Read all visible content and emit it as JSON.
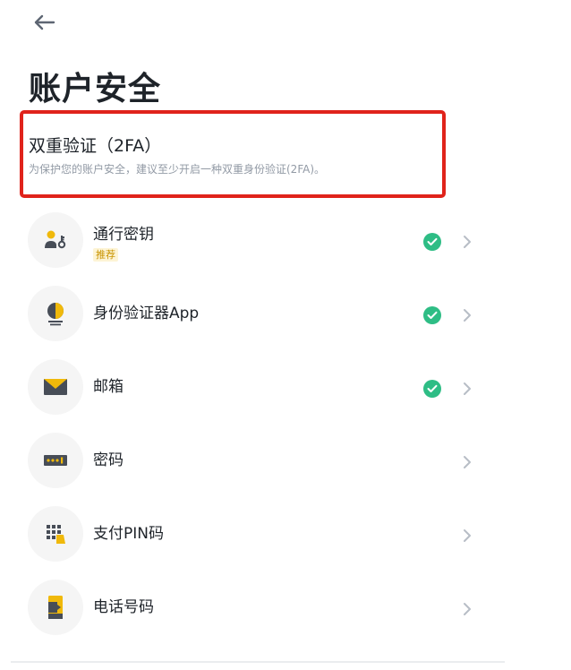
{
  "header": {
    "title": "账户安全"
  },
  "twofa": {
    "title": "双重验证（2FA）",
    "description": "为保护您的账户安全，建议至少开启一种双重身份验证(2FA)。"
  },
  "items": [
    {
      "label": "通行密钥",
      "badge": "推荐",
      "verified": true,
      "icon": "passkey-icon"
    },
    {
      "label": "身份验证器App",
      "verified": true,
      "icon": "authenticator-icon"
    },
    {
      "label": "邮箱",
      "verified": true,
      "icon": "email-icon"
    },
    {
      "label": "密码",
      "verified": false,
      "icon": "password-icon"
    },
    {
      "label": "支付PIN码",
      "verified": false,
      "icon": "pin-icon"
    },
    {
      "label": "电话号码",
      "verified": false,
      "icon": "phone-icon"
    }
  ],
  "colors": {
    "accent": "#f0b90b",
    "success": "#2ebd85",
    "highlight_border": "#e0231b",
    "text_primary": "#1e2329",
    "text_secondary": "#929aa5",
    "icon_bg": "#f5f5f5"
  }
}
